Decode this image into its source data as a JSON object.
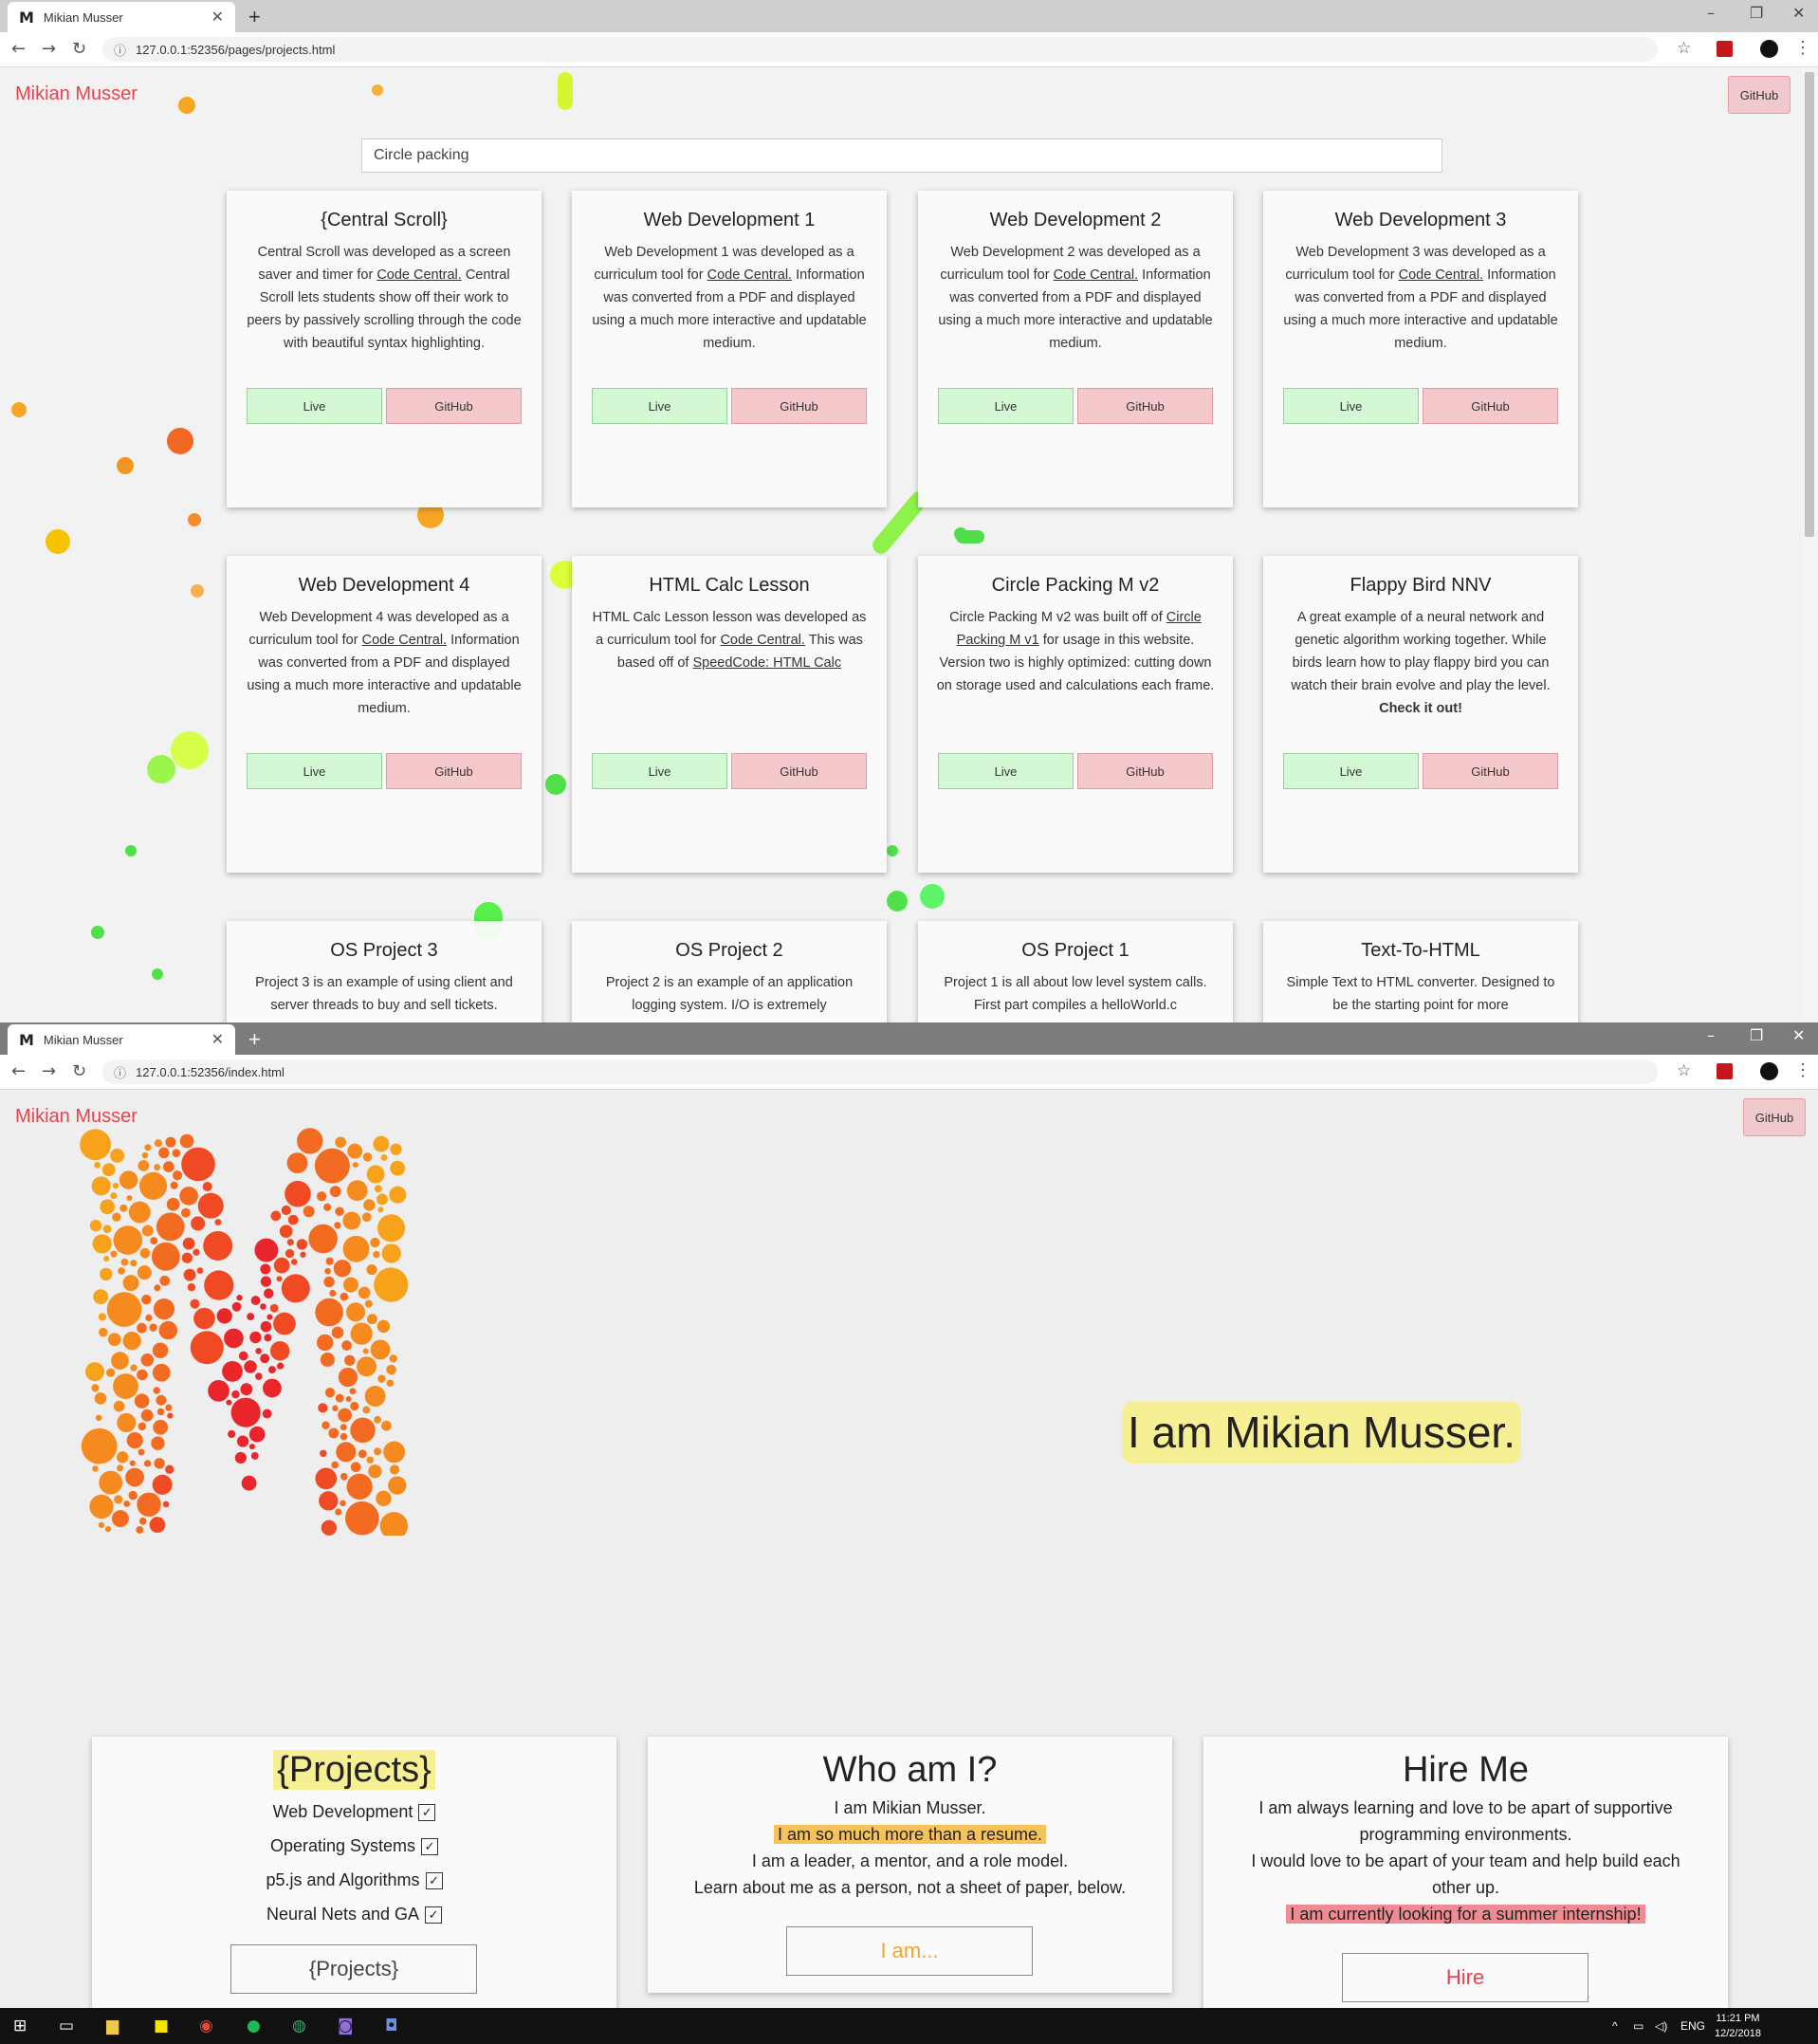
{
  "window1": {
    "tab_title": "Mikian Musser",
    "favicon": "M",
    "url": "127.0.0.1:52356/pages/projects.html",
    "brand": "Mikian Musser",
    "github_label": "GitHub",
    "search_value": "Circle packing",
    "live_label": "Live",
    "gh_label": "GitHub",
    "cards": [
      {
        "title": "{Central Scroll}",
        "text": "Central Scroll was developed as a screen saver and timer for ",
        "link": "Code Central.",
        "tail": " Central Scroll lets students show off their work to peers by passively scrolling through the code with beautiful syntax highlighting."
      },
      {
        "title": "Web Development 1",
        "text": "Web Development 1 was developed as a curriculum tool for ",
        "link": "Code Central.",
        "tail": " Information was converted from a PDF and displayed using a much more interactive and updatable medium."
      },
      {
        "title": "Web Development 2",
        "text": "Web Development 2 was developed as a curriculum tool for ",
        "link": "Code Central.",
        "tail": " Information was converted from a PDF and displayed using a much more interactive and updatable medium."
      },
      {
        "title": "Web Development 3",
        "text": "Web Development 3 was developed as a curriculum tool for ",
        "link": "Code Central.",
        "tail": " Information was converted from a PDF and displayed using a much more interactive and updatable medium."
      },
      {
        "title": "Web Development 4",
        "text": "Web Development 4 was developed as a curriculum tool for ",
        "link": "Code Central.",
        "tail": " Information was converted from a PDF and displayed using a much more interactive and updatable medium."
      },
      {
        "title": "HTML Calc Lesson",
        "text": "HTML Calc Lesson lesson was developed as a curriculum tool for ",
        "link": "Code Central.",
        "tail": " This was based off of ",
        "link2": "SpeedCode: HTML Calc"
      },
      {
        "title": "Circle Packing M v2",
        "text": "Circle Packing M v2 was built off of ",
        "link": "Circle Packing M v1",
        "tail": " for usage in this website. Version two is highly optimized: cutting down on storage used and calculations each frame."
      },
      {
        "title": "Flappy Bird NNV",
        "text": "A great example of a neural network and genetic algorithm working together. While birds learn how to play flappy bird you can watch their brain evolve and play the level. ",
        "bold": "Check it out!"
      },
      {
        "title": "OS Project 3",
        "text": "Project 3 is an example of using client and server threads to buy and sell tickets."
      },
      {
        "title": "OS Project 2",
        "text": "Project 2 is an example of an application logging system. I/O is extremely"
      },
      {
        "title": "OS Project 1",
        "text": "Project 1 is all about low level system calls. First part compiles a helloWorld.c"
      },
      {
        "title": "Text-To-HTML",
        "text": "Simple Text to HTML converter. Designed to be the starting point for more"
      }
    ]
  },
  "window2": {
    "tab_title": "Mikian Musser",
    "favicon": "M",
    "url": "127.0.0.1:52356/index.html",
    "brand": "Mikian Musser",
    "github_label": "GitHub",
    "headline": "I am Mikian Musser.",
    "projects": {
      "title": "{Projects}",
      "items": [
        "Web Development",
        "Operating Systems",
        "p5.js and Algorithms",
        "Neural Nets and GA"
      ],
      "check": "✓",
      "button": "{Projects}"
    },
    "who": {
      "title": "Who am I?",
      "line1": "I am Mikian Musser.",
      "line2": "I am so much more than a resume.",
      "line3": "I am a leader, a mentor, and a role model.",
      "line4": "Learn about me as a person, not a sheet of paper, below.",
      "button": "I am..."
    },
    "hire": {
      "title": "Hire Me",
      "line1": "I am always learning and love to be apart of supportive",
      "line2": "programming environments.",
      "line3": "I would love to be apart of your team and help build each",
      "line4": "other up.",
      "line5": "I am currently looking for a summer internship!",
      "button": "Hire"
    }
  },
  "taskbar": {
    "lang": "ENG",
    "time": "11:21 PM",
    "date": "12/2/2018"
  },
  "colors": {
    "brand_red": "#e8424f",
    "live_green": "#d4f7d4",
    "github_pink": "#f5c8cc",
    "highlight_yellow": "#f6ef93",
    "highlight_orange": "#f8c25a",
    "highlight_red": "#f08a93"
  }
}
